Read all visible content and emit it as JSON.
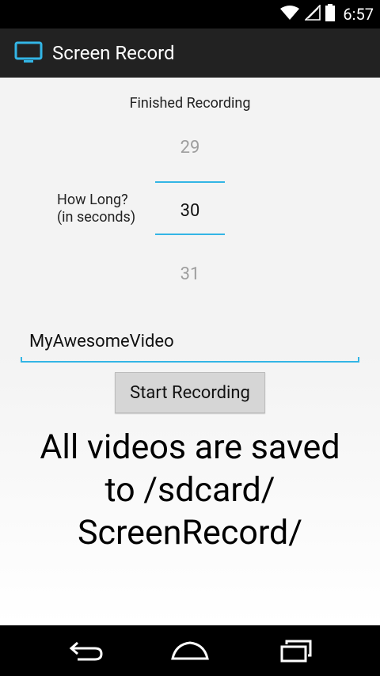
{
  "status_bar": {
    "time": "6:57"
  },
  "action_bar": {
    "title": "Screen Record"
  },
  "main": {
    "status_text": "Finished Recording",
    "duration_label_line1": "How Long?",
    "duration_label_line2": "(in seconds)",
    "picker": {
      "prev": "29",
      "current": "30",
      "next": "31"
    },
    "filename_value": "MyAwesomeVideo",
    "start_button_label": "Start Recording",
    "saved_line1": "All videos are saved",
    "saved_line2": "to /sdcard/",
    "saved_line3": "ScreenRecord/"
  },
  "colors": {
    "accent": "#33b5e5",
    "action_bar": "#222222"
  },
  "icons": [
    "wifi-icon",
    "signal-icon",
    "battery-icon",
    "monitor-icon",
    "back-icon",
    "home-icon",
    "recents-icon"
  ]
}
